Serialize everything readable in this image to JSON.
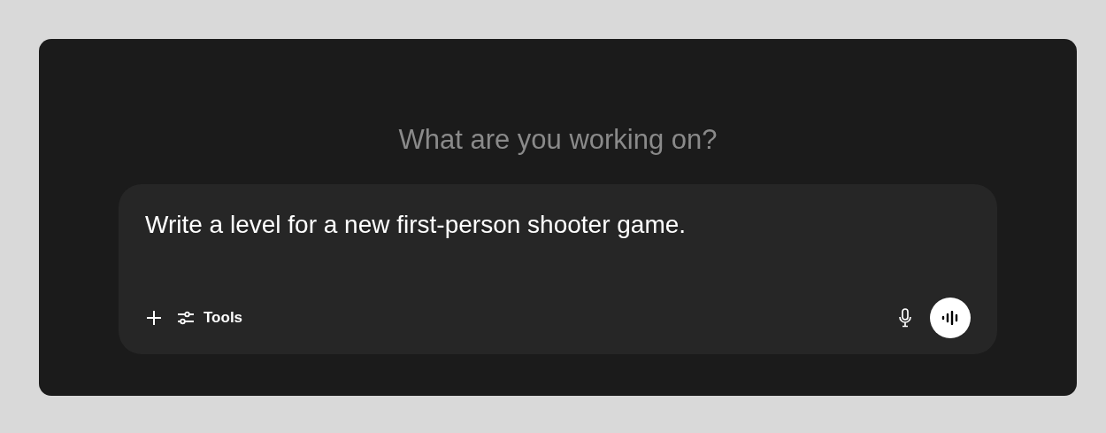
{
  "heading": "What are you working on?",
  "prompt": {
    "value": "Write a level for a new first-person shooter game."
  },
  "toolbar": {
    "tools_label": "Tools"
  }
}
